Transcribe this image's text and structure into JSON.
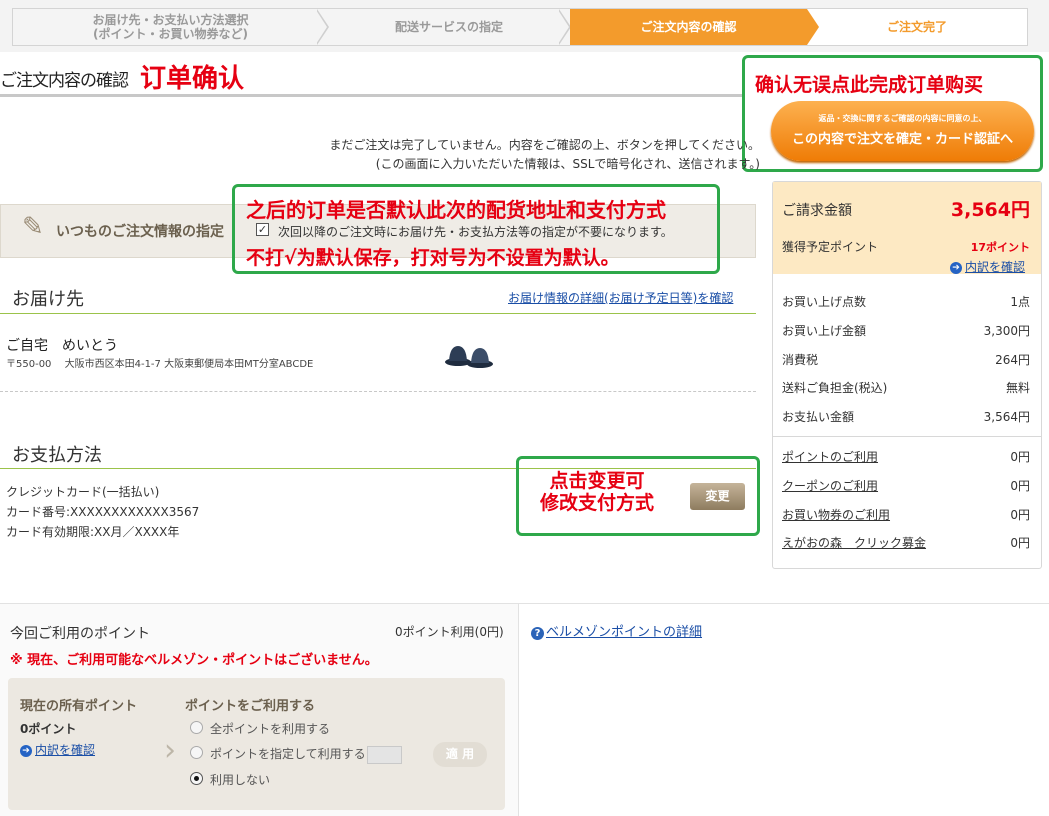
{
  "steps": [
    {
      "label_line1": "お届け先・お支払い方法選択",
      "label_line2": "(ポイント・お買い物券など)"
    },
    {
      "label_line1": "配送サービスの指定",
      "label_line2": ""
    },
    {
      "label_line1": "ご注文内容の確認",
      "label_line2": ""
    },
    {
      "label_line1": "ご注文完了",
      "label_line2": ""
    }
  ],
  "page": {
    "title": "ご注文内容の確認",
    "title_note": "订单确认"
  },
  "confirm": {
    "note": "确认无误点此完成订单购买",
    "button_line1": "返品・交換に関するご確認の内容に同意の上、",
    "button_line2": "この内容で注文を確定・カード認証へ"
  },
  "notice": {
    "line1": "まだご注文は完了していません。内容をご確認の上、ボタンを押してください。",
    "line2": "(この画面に入力いただいた情報は、SSLで暗号化され、送信されます。)"
  },
  "usual": {
    "label": "いつものご注文情報の指定",
    "note_line1": "之后的订单是否默认此次的配货地址和支付方式",
    "note_line2": "不打√为默认保存，打对号为不设置为默认。",
    "checkbox_mark": "✓",
    "checkbox_label": "次回以降のご注文時にお届け先・お支払方法等の指定が不要になります。"
  },
  "delivery": {
    "heading": "お届け先",
    "detail_link": "お届け情報の詳細(お届け予定日等)を確認",
    "name": "ご自宅　めいとう",
    "address": "〒550-00　 大阪市西区本田4-1-7 大阪東郵便局本田MT分室ABCDE"
  },
  "payment": {
    "heading": "お支払方法",
    "method": "クレジットカード(一括払い)",
    "card_number": "カード番号:XXXXXXXXXXXX3567",
    "expiry": "カード有効期限:XX月／XXXX年",
    "note_line1": "点击变更可",
    "note_line2": "修改支付方式",
    "change_button": "変更"
  },
  "summary": {
    "total_label": "ご請求金額",
    "total_value": "3,564円",
    "points_label": "獲得予定ポイント",
    "points_value": "17ポイント",
    "breakdown_link": "内訳を確認",
    "rows": [
      {
        "label": "お買い上げ点数",
        "value": "1点"
      },
      {
        "label": "お買い上げ金額",
        "value": "3,300円"
      },
      {
        "label": "消費税",
        "value": "264円"
      },
      {
        "label": "送料ご負担金(税込)",
        "value": "無料"
      },
      {
        "label": "お支払い金額",
        "value": "3,564円"
      }
    ],
    "links": [
      {
        "label": "ポイントのご利用",
        "value": "0円"
      },
      {
        "label": "クーポンのご利用",
        "value": "0円"
      },
      {
        "label": "お買い物券のご利用",
        "value": "0円"
      },
      {
        "label": "えがおの森　クリック募金",
        "value": "0円"
      }
    ]
  },
  "points": {
    "title": "今回ご利用のポイント",
    "used": "0ポイント利用(0円)",
    "warning": "※ 現在、ご利用可能なベルメゾン・ポイントはございません。",
    "detail_link": "ベルメゾンポイントの詳細",
    "owned_heading": "現在の所有ポイント",
    "owned_value": "0ポイント",
    "owned_link": "内訳を確認",
    "use_heading": "ポイントをご利用する",
    "options": [
      "全ポイントを利用する",
      "ポイントを指定して利用する",
      "利用しない"
    ],
    "apply_button": "適 用"
  }
}
